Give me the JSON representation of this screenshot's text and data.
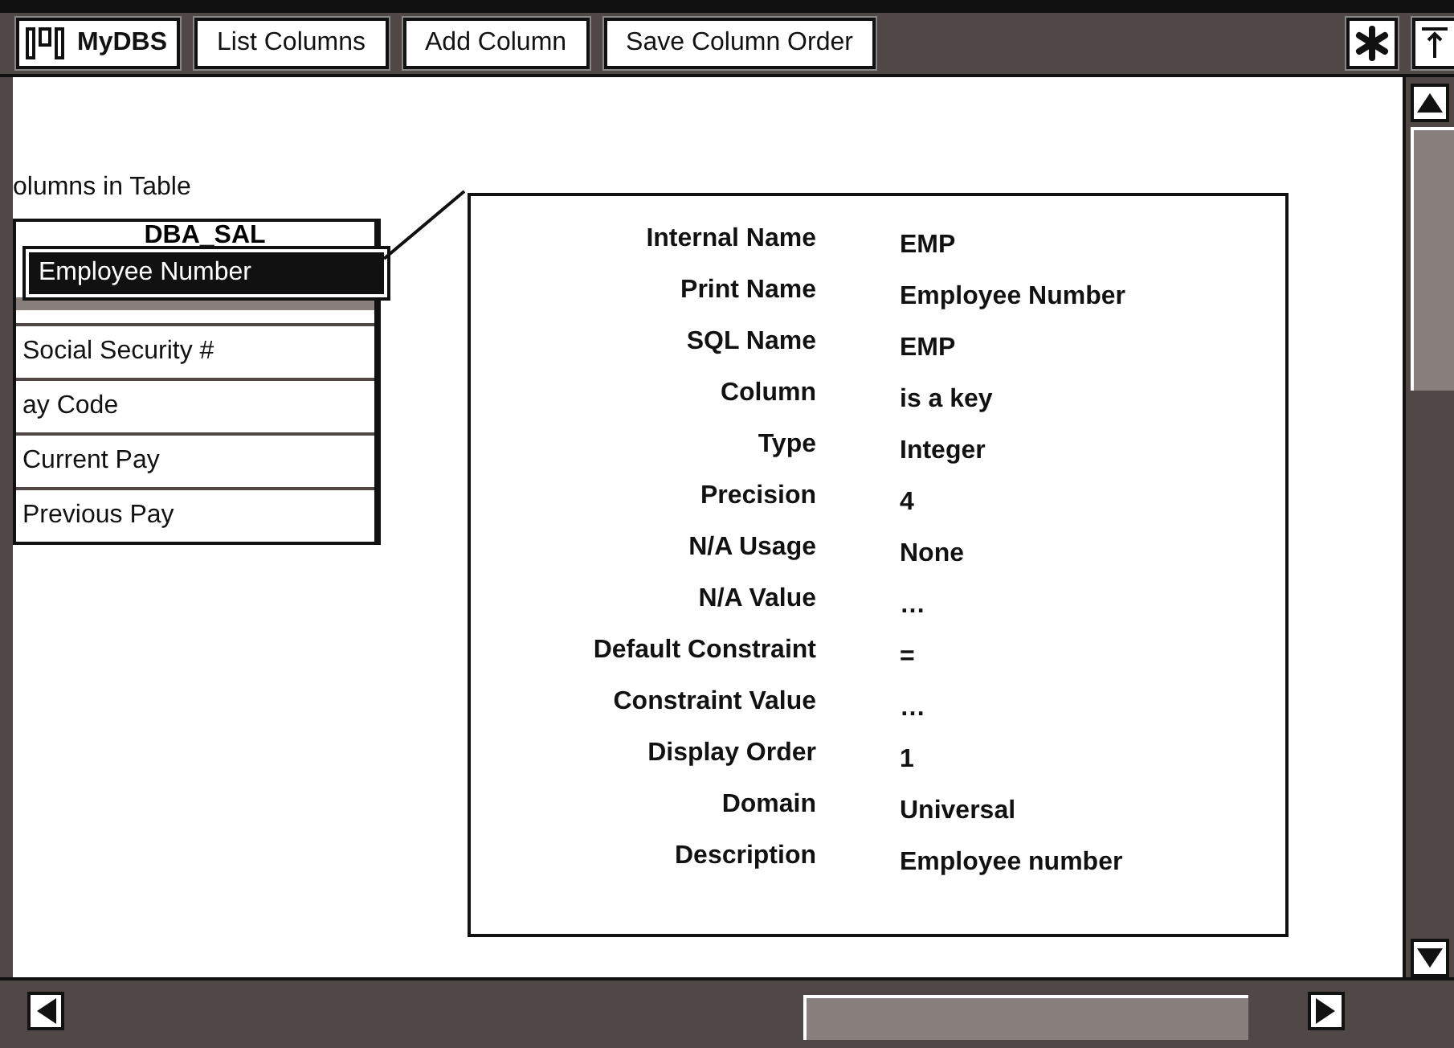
{
  "toolbar": {
    "app_name": "MyDBS",
    "buttons": [
      "List Columns",
      "Add Column",
      "Save Column Order"
    ]
  },
  "columns_list": {
    "caption": "olumns in Table",
    "header": "DBA_SAL",
    "items": [
      {
        "label": "Employee Number",
        "selected": true
      },
      {
        "label": "Social Security #",
        "selected": false
      },
      {
        "label": "ay Code",
        "selected": false
      },
      {
        "label": "Current Pay",
        "selected": false
      },
      {
        "label": "Previous Pay",
        "selected": false
      }
    ]
  },
  "details": [
    {
      "label": "Internal Name",
      "value": "EMP"
    },
    {
      "label": "Print Name",
      "value": "Employee Number"
    },
    {
      "label": "SQL Name",
      "value": "EMP"
    },
    {
      "label": "Column",
      "value": "is a key"
    },
    {
      "label": "Type",
      "value": "Integer"
    },
    {
      "label": "Precision",
      "value": "4"
    },
    {
      "label": "N/A Usage",
      "value": "None"
    },
    {
      "label": "N/A Value",
      "value": "…"
    },
    {
      "label": "Default Constraint",
      "value": "="
    },
    {
      "label": "Constraint Value",
      "value": "…"
    },
    {
      "label": "Display Order",
      "value": "1"
    },
    {
      "label": "Domain",
      "value": "Universal"
    },
    {
      "label": "Description",
      "value": "Employee number"
    }
  ]
}
